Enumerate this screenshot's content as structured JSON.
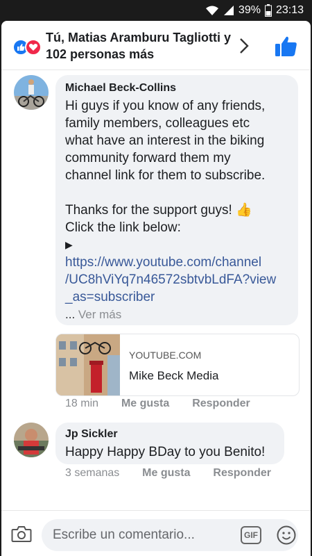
{
  "status_bar": {
    "battery_percent": "39%",
    "time": "23:13"
  },
  "reactions": {
    "text": "Tú, Matias Aramburu Tagliotti y 102 personas más"
  },
  "comments": [
    {
      "author": "Michael Beck-Collins",
      "lines": [
        "Hi guys if you know of any friends,",
        "family members, colleagues etc",
        "what have an interest in the biking",
        "community forward them my",
        "channel link for them to subscribe."
      ],
      "thanks": "Thanks for the support guys! 👍",
      "click": "Click the link below:",
      "arrow": "▶",
      "link_lines": [
        "https://www.youtube.com/channel",
        "/UC8hViYq7n46572sbtvbLdFA?view",
        "_as=subscriber"
      ],
      "ellipsis": "...",
      "see_more": "Ver más",
      "preview": {
        "source": "YOUTUBE.COM",
        "title": "Mike Beck Media"
      },
      "time": "18 min",
      "like": "Me gusta",
      "reply": "Responder"
    },
    {
      "author": "Jp Sickler",
      "text": "Happy Happy BDay to you Benito!",
      "time": "3 semanas",
      "like": "Me gusta",
      "reply": "Responder"
    }
  ],
  "composer": {
    "placeholder": "Escribe un comentario...",
    "gif": "GIF"
  },
  "colors": {
    "facebook_blue": "#1877f2",
    "link": "#385898",
    "bubble": "#f0f2f5",
    "muted": "#8a8d91"
  },
  "icons": [
    "wifi-icon",
    "signal-icon",
    "battery-icon",
    "like-reaction-icon",
    "love-reaction-icon",
    "chevron-right-icon",
    "thumbs-up-icon",
    "camera-icon",
    "gif-icon",
    "emoji-icon"
  ]
}
